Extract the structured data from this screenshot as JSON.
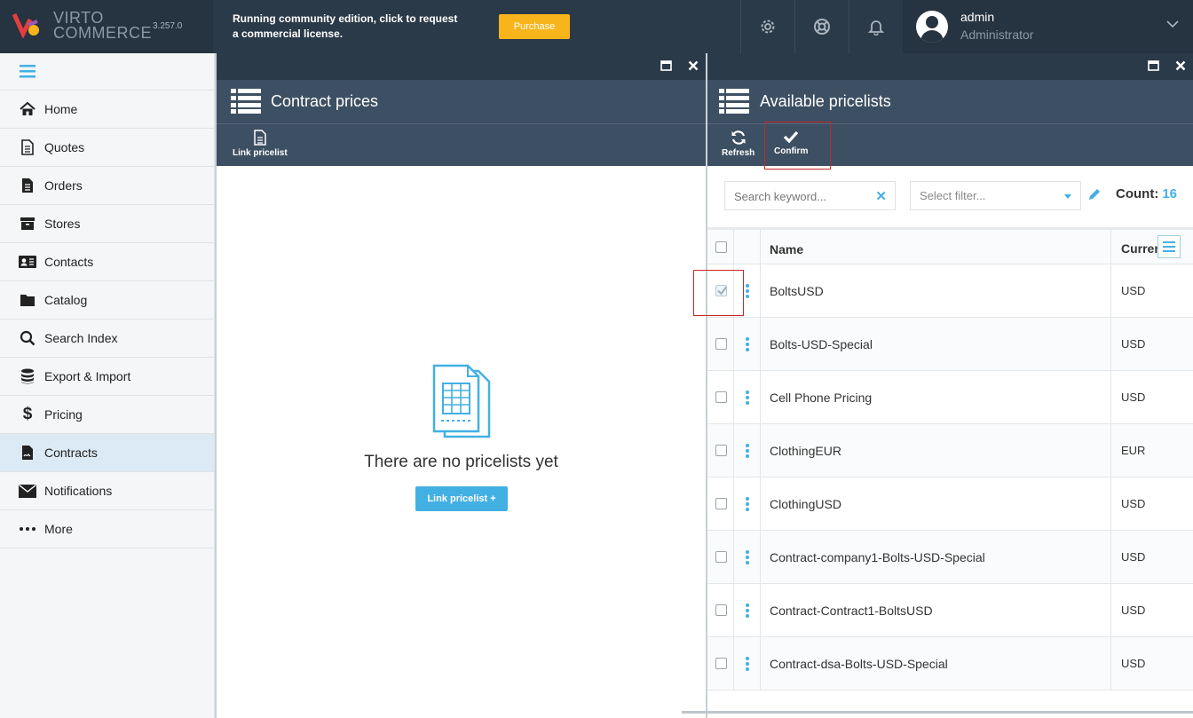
{
  "header": {
    "logo_line1": "VIRTO",
    "logo_line2": "COMMERCE",
    "version": "3.257.0",
    "notice": "Running community edition, click to request a commercial license.",
    "purchase_label": "Purchase",
    "user_name": "admin",
    "user_role": "Administrator"
  },
  "sidebar": {
    "items": [
      {
        "label": "Home",
        "icon": "home-icon"
      },
      {
        "label": "Quotes",
        "icon": "document-icon"
      },
      {
        "label": "Orders",
        "icon": "file-text-icon"
      },
      {
        "label": "Stores",
        "icon": "archive-icon"
      },
      {
        "label": "Contacts",
        "icon": "id-card-icon"
      },
      {
        "label": "Catalog",
        "icon": "folder-icon"
      },
      {
        "label": "Search Index",
        "icon": "search-icon"
      },
      {
        "label": "Export & Import",
        "icon": "database-icon"
      },
      {
        "label": "Pricing",
        "icon": "dollar-icon"
      },
      {
        "label": "Contracts",
        "icon": "contract-icon"
      },
      {
        "label": "Notifications",
        "icon": "envelope-icon"
      },
      {
        "label": "More",
        "icon": "ellipsis-icon"
      }
    ],
    "active": "Contracts"
  },
  "blade_contract_prices": {
    "title": "Contract prices",
    "toolbar_link": "Link pricelist",
    "empty_text": "There are no pricelists yet",
    "empty_button": "Link pricelist +"
  },
  "blade_available": {
    "title": "Available pricelists",
    "toolbar_refresh": "Refresh",
    "toolbar_confirm": "Confirm",
    "search_placeholder": "Search keyword...",
    "filter_placeholder": "Select filter...",
    "count_label": "Count:",
    "count_value": "16",
    "col_name": "Name",
    "col_currency": "Curren",
    "rows": [
      {
        "name": "BoltsUSD",
        "currency": "USD",
        "checked": true
      },
      {
        "name": "Bolts-USD-Special",
        "currency": "USD",
        "checked": false
      },
      {
        "name": "Cell Phone Pricing",
        "currency": "USD",
        "checked": false
      },
      {
        "name": "ClothingEUR",
        "currency": "EUR",
        "checked": false
      },
      {
        "name": "ClothingUSD",
        "currency": "USD",
        "checked": false
      },
      {
        "name": "Contract-company1-Bolts-USD-Special",
        "currency": "USD",
        "checked": false
      },
      {
        "name": "Contract-Contract1-BoltsUSD",
        "currency": "USD",
        "checked": false
      },
      {
        "name": "Contract-dsa-Bolts-USD-Special",
        "currency": "USD",
        "checked": false
      }
    ]
  },
  "colors": {
    "topbar": "#2b3a49",
    "blade_header": "#3d4f62",
    "accent": "#43b0e4",
    "purchase": "#f7b51b",
    "highlight": "#c62828"
  }
}
